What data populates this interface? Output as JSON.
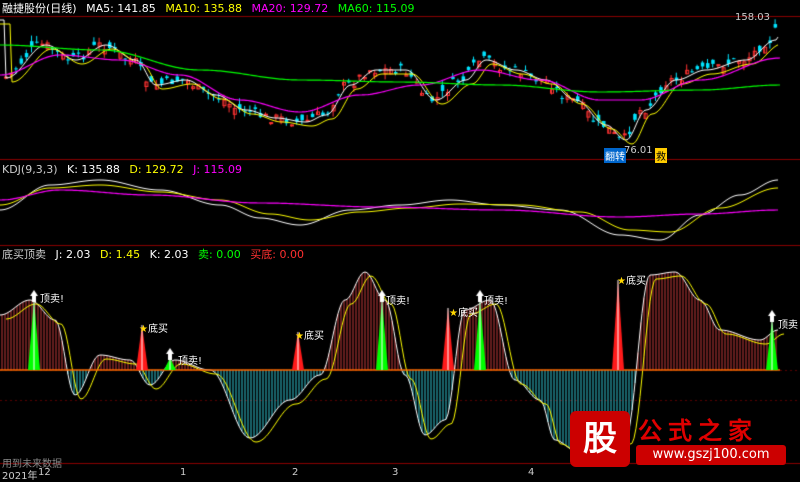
{
  "main": {
    "title": "融捷股份(日线)",
    "ma": [
      {
        "label": "MA5: 141.85",
        "color": "#ffffff"
      },
      {
        "label": "MA10: 135.88",
        "color": "#ffff00"
      },
      {
        "label": "MA20: 129.72",
        "color": "#ff00ff"
      },
      {
        "label": "MA60: 115.09",
        "color": "#00ff00"
      }
    ],
    "high_label": "158.03",
    "low_label": "76.01",
    "tag_1": "翻",
    "tag_2": "转",
    "tag_3": "救"
  },
  "kdj": {
    "name": "KDJ(9,3,3)",
    "k": "K: 135.88",
    "d": "D: 129.72",
    "j": "J: 115.09",
    "colors": {
      "k": "#ffffff",
      "d": "#ffff00",
      "j": "#ff00ff"
    }
  },
  "signal": {
    "name": "底买顶卖",
    "j": "J: 2.03",
    "d": "D: 1.45",
    "k": "K: 2.03",
    "sell": "卖: 0.00",
    "buy": "买底: 0.00",
    "colors": {
      "sell": "#00ff00",
      "buy": "#ff3030"
    },
    "labels": [
      {
        "text": "顶卖!",
        "type": "sell"
      },
      {
        "text": "底买",
        "type": "buy"
      },
      {
        "text": "顶卖!",
        "type": "sell"
      },
      {
        "text": "底买",
        "type": "buy"
      },
      {
        "text": "顶卖!",
        "type": "sell"
      },
      {
        "text": "底买",
        "type": "buy"
      },
      {
        "text": "顶卖!",
        "type": "sell"
      },
      {
        "text": "底买",
        "type": "buy"
      },
      {
        "text": "顶卖",
        "type": "sell"
      }
    ],
    "future_data_note": "用到未来数据"
  },
  "xaxis": {
    "year": "2021年",
    "ticks": [
      "12",
      "1",
      "2",
      "3",
      "4"
    ]
  },
  "watermark": {
    "box": "股",
    "title": "公式之家",
    "url": "www.gszj100.com"
  },
  "chart_data": {
    "type": "candlestick",
    "colors": {
      "up": "#ff3232",
      "down": "#00e5ff",
      "border": "#a00000"
    }
  }
}
